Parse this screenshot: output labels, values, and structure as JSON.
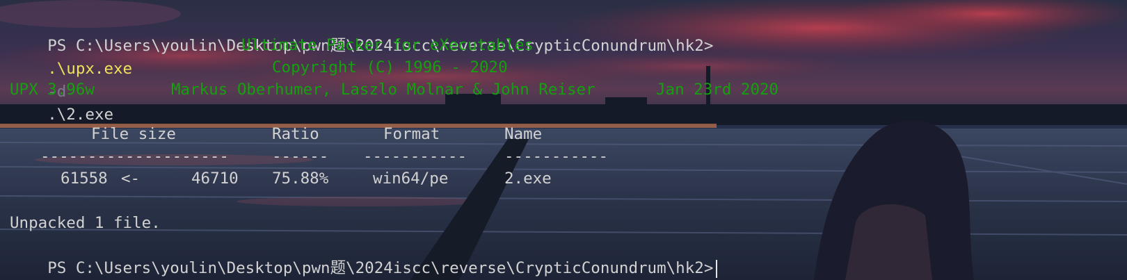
{
  "colors": {
    "prompt_text": "#d2d2d2",
    "upx_banner": "#13a10e",
    "command": "#f0e05a",
    "flag": "#7a7a8a",
    "sky_red": "#9c2f3d",
    "night_blue": "#1c2336"
  },
  "terminal": {
    "prompt_path": "PS C:\\Users\\youlin\\Desktop\\pwn题\\2024iscc\\reverse\\CrypticConundrum\\hk2>",
    "command": {
      "program": ".\\upx.exe",
      "flag": "-d",
      "argument": ".\\2.exe"
    },
    "banner": {
      "title": "Ultimate Packer for eXecutables",
      "copyright": "Copyright (C) 1996 - 2020",
      "version": "UPX 3.96w",
      "authors": "Markus Oberhumer, Laszlo Molnar & John Reiser",
      "date": "Jan 23rd 2020"
    },
    "table": {
      "headers": {
        "file_size": "File size",
        "ratio": "Ratio",
        "format": "Format",
        "name": "Name"
      },
      "separators": {
        "file_size": "--------------------",
        "ratio": "------",
        "format": "-----------",
        "name": "-----------"
      },
      "row": {
        "original_size": "61558",
        "arrow": "<-",
        "packed_size": "46710",
        "ratio": "75.88%",
        "format": "win64/pe",
        "name": "2.exe"
      }
    },
    "result": "Unpacked 1 file.",
    "final_prompt": "PS C:\\Users\\youlin\\Desktop\\pwn题\\2024iscc\\reverse\\CrypticConundrum\\hk2>"
  }
}
